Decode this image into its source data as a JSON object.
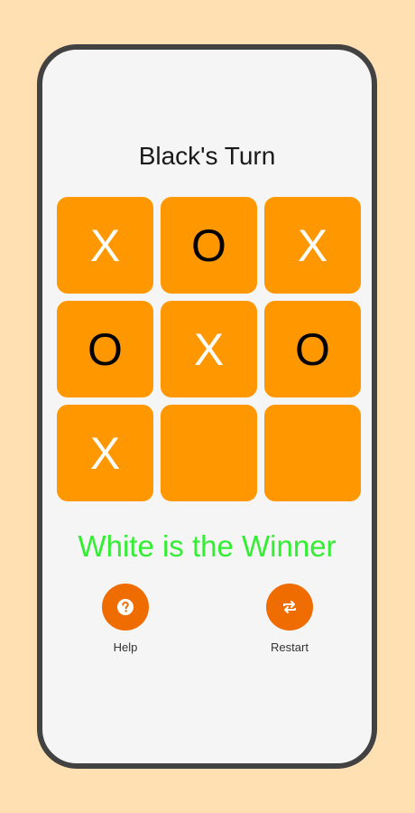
{
  "game": {
    "turn_text": "Black's Turn",
    "board": [
      "X",
      "O",
      "X",
      "O",
      "X",
      "O",
      "X",
      "",
      ""
    ],
    "status_text": "White is the Winner"
  },
  "actions": {
    "help_label": "Help",
    "restart_label": "Restart"
  },
  "icons": {
    "help": "help-circle-icon",
    "restart": "repeat-icon"
  },
  "colors": {
    "background": "#FFE0B3",
    "phone_frame": "#424242",
    "screen": "#F5F5F5",
    "cell": "#FF9800",
    "button": "#EF6C00",
    "winner_text": "#33EE33"
  }
}
